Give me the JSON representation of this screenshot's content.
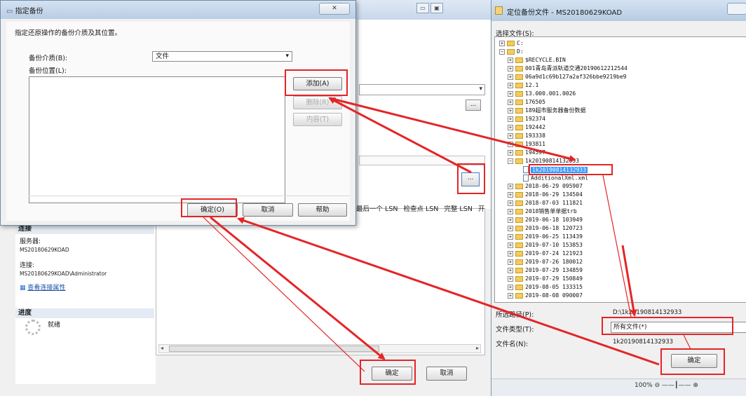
{
  "bg_window": {
    "column_headers": [
      "最后一个 LSN",
      "检查点 LSN",
      "完整 LSN",
      "开"
    ],
    "connection_header": "连接",
    "server_label": "服务器:",
    "server_value": "MS20180629KOAD",
    "connect_label": "连接:",
    "connect_value": "MS20180629KOAD\\Administrator",
    "view_props_link": "查看连接属性",
    "progress_header": "进度",
    "progress_status": "就绪",
    "ellipsis": "...",
    "ok_label": "确定",
    "cancel_label": "取消"
  },
  "specify_backup_dialog": {
    "title": "指定备份",
    "instruction": "指定还原操作的备份介质及其位置。",
    "media_label": "备份介质(B):",
    "media_value": "文件",
    "location_label": "备份位置(L):",
    "add_button": "添加(A)",
    "remove_button": "删除(R)",
    "contents_button": "内容(T)",
    "ok_button": "确定(O)",
    "cancel_button": "取消",
    "help_button": "帮助"
  },
  "locate_file_dialog": {
    "title": "定位备份文件 - MS20180629KOAD",
    "select_file_label": "选择文件(S):",
    "tree": [
      {
        "label": "C:",
        "type": "drive",
        "expander": "+"
      },
      {
        "label": "D:",
        "type": "drive",
        "expander": "−"
      },
      {
        "label": "$RECYCLE.BIN",
        "type": "folder",
        "expander": "+"
      },
      {
        "label": "001青岛青派轨道交通20190612212544",
        "type": "folder",
        "expander": "+"
      },
      {
        "label": "06a9d1c69b127a2af326bbe9219be9",
        "type": "folder",
        "expander": "+"
      },
      {
        "label": "12.1",
        "type": "folder",
        "expander": "+"
      },
      {
        "label": "13.000.001.0026",
        "type": "folder",
        "expander": "+"
      },
      {
        "label": "176505",
        "type": "folder",
        "expander": "+"
      },
      {
        "label": "189超市服务器备份数据",
        "type": "folder",
        "expander": "+"
      },
      {
        "label": "192374",
        "type": "folder",
        "expander": "+"
      },
      {
        "label": "192442",
        "type": "folder",
        "expander": "+"
      },
      {
        "label": "193338",
        "type": "folder",
        "expander": "+"
      },
      {
        "label": "193811",
        "type": "folder",
        "expander": "+"
      },
      {
        "label": "194597",
        "type": "folder",
        "expander": "+"
      },
      {
        "label": "1k20190814132933",
        "type": "folder",
        "expander": "−"
      },
      {
        "label": "1k20190814132933",
        "type": "file",
        "selected": true
      },
      {
        "label": "AdditionalXml.xml",
        "type": "file"
      },
      {
        "label": "2018-06-29 095907",
        "type": "folder",
        "expander": "+"
      },
      {
        "label": "2018-06-29 134504",
        "type": "folder",
        "expander": "+"
      },
      {
        "label": "2018-07-03 111821",
        "type": "folder",
        "expander": "+"
      },
      {
        "label": "2018销售单单据trb",
        "type": "folder",
        "expander": "+"
      },
      {
        "label": "2019-06-18 103949",
        "type": "folder",
        "expander": "+"
      },
      {
        "label": "2019-06-18 120723",
        "type": "folder",
        "expander": "+"
      },
      {
        "label": "2019-06-25 113439",
        "type": "folder",
        "expander": "+"
      },
      {
        "label": "2019-07-10 153853",
        "type": "folder",
        "expander": "+"
      },
      {
        "label": "2019-07-24 121923",
        "type": "folder",
        "expander": "+"
      },
      {
        "label": "2019-07-26 180012",
        "type": "folder",
        "expander": "+"
      },
      {
        "label": "2019-07-29 134859",
        "type": "folder",
        "expander": "+"
      },
      {
        "label": "2019-07-29 150849",
        "type": "folder",
        "expander": "+"
      },
      {
        "label": "2019-08-05 133315",
        "type": "folder",
        "expander": "+"
      },
      {
        "label": "2019-08-08 090007",
        "type": "folder",
        "expander": "+"
      }
    ],
    "selected_path_label": "所选路径(P):",
    "selected_path_value": "D:\\1k20190814132933",
    "file_type_label": "文件类型(T):",
    "file_type_value": "所有文件(*)",
    "file_name_label": "文件名(N):",
    "file_name_value": "1k20190814132933",
    "ok_button": "确定",
    "zoom": "100%"
  }
}
